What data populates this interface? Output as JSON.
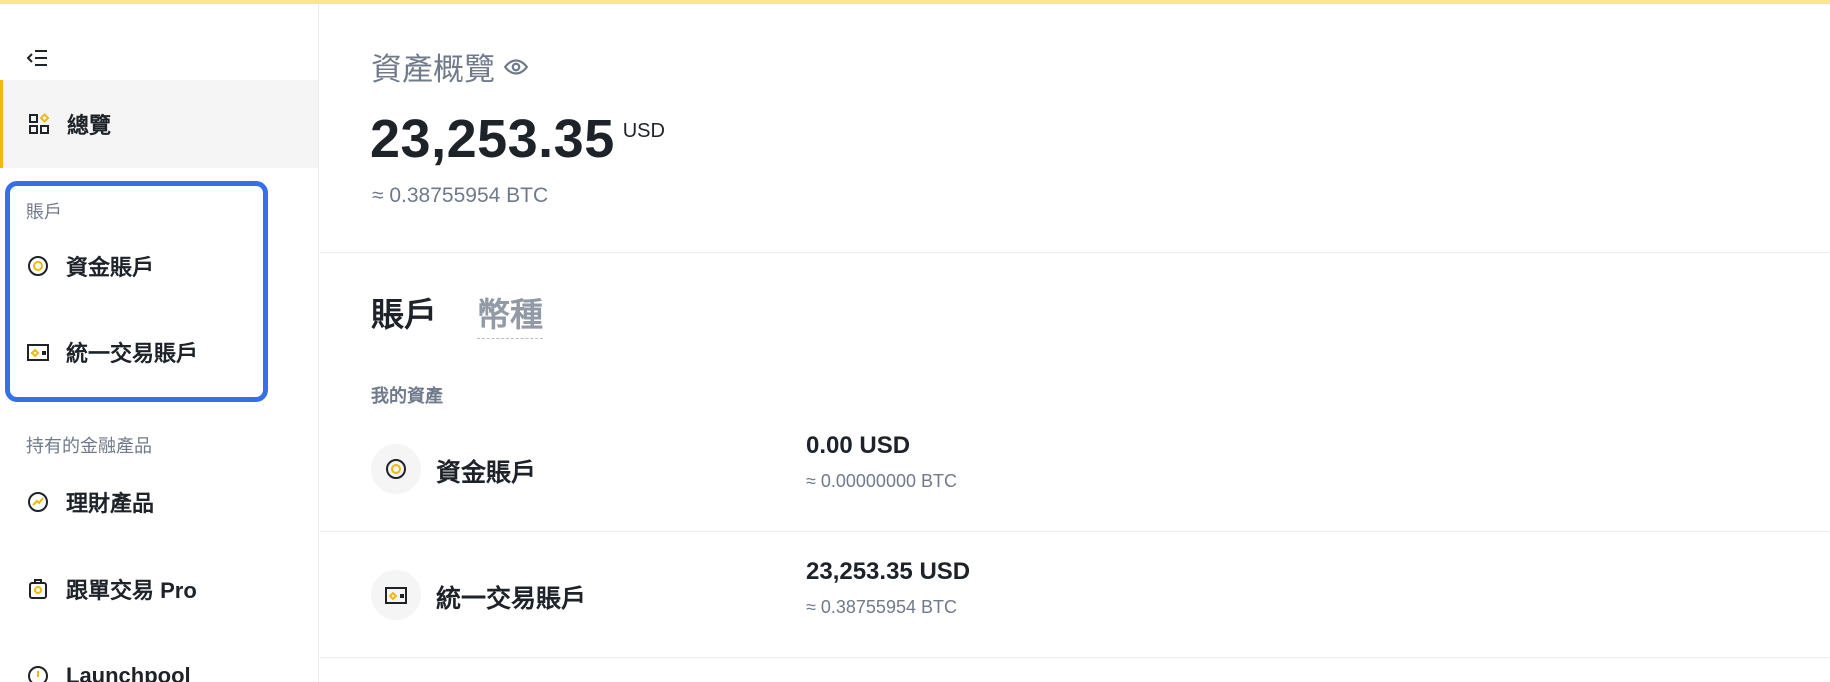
{
  "colors": {
    "accent": "#f0b90b",
    "highlight_border": "#3370ea",
    "text_primary": "#1e2329",
    "text_secondary": "#707a8a",
    "top_bar": "#fde58a"
  },
  "sidebar": {
    "collapse_icon": "collapse-menu-icon",
    "overview": {
      "label": "總覽",
      "icon": "dashboard-grid-icon"
    },
    "accounts_section": "賬戶",
    "accounts": [
      {
        "label": "資金賬戶",
        "icon": "funding-coin-icon"
      },
      {
        "label": "統一交易賬戶",
        "icon": "wallet-icon"
      }
    ],
    "products_section": "持有的金融產品",
    "products": [
      {
        "label": "理財產品",
        "icon": "earn-icon"
      },
      {
        "label": "跟單交易 Pro",
        "icon": "copy-trading-icon"
      },
      {
        "label": "Launchpool",
        "icon": "launchpool-icon"
      }
    ]
  },
  "main": {
    "title": "資產概覽",
    "eye_icon": "eye-icon",
    "balance": "23,253.35",
    "balance_unit": "USD",
    "balance_btc": "≈ 0.38755954 BTC",
    "tabs": [
      {
        "label": "賬戶",
        "active": true
      },
      {
        "label": "幣種",
        "active": false
      }
    ],
    "my_assets_label": "我的資產",
    "assets": [
      {
        "name": "資金賬戶",
        "amount": "0.00 USD",
        "btc": "≈ 0.00000000 BTC",
        "icon": "funding-coin-icon"
      },
      {
        "name": "統一交易賬戶",
        "amount": "23,253.35 USD",
        "btc": "≈ 0.38755954 BTC",
        "icon": "wallet-icon"
      }
    ]
  }
}
